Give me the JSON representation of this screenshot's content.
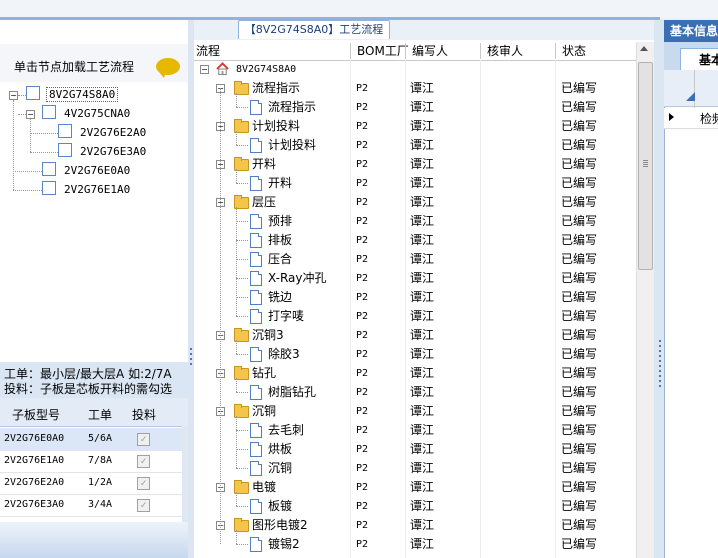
{
  "window": {
    "title": "【8V2G74S8A0】工艺流程"
  },
  "left_panel": {
    "hint": "单击节点加载工艺流程",
    "tree": [
      {
        "label": "8V2G74S8A0",
        "selected": true
      },
      {
        "label": "4V2G75CNA0"
      },
      {
        "label": "2V2G76E2A0"
      },
      {
        "label": "2V2G76E3A0"
      },
      {
        "label": "2V2G76E0A0"
      },
      {
        "label": "2V2G76E1A0"
      }
    ],
    "note_line1": "工单：最小层/最大层A 如:2/7A",
    "note_line2": "投料：子板是芯板开料的需勾选",
    "sub_table": {
      "headers": [
        "子板型号",
        "工单",
        "投料"
      ],
      "rows": [
        {
          "model": "2V2G76E0A0",
          "order": "5/6A",
          "feed": true
        },
        {
          "model": "2V2G76E1A0",
          "order": "7/8A",
          "feed": true
        },
        {
          "model": "2V2G76E2A0",
          "order": "1/2A",
          "feed": true
        },
        {
          "model": "2V2G76E3A0",
          "order": "3/4A",
          "feed": true
        }
      ]
    }
  },
  "process_table": {
    "headers": {
      "flow": "流程",
      "bom": "BOM工厂",
      "writer": "编写人",
      "reviewer": "核审人",
      "status": "状态"
    },
    "rows": [
      {
        "name": "8V2G74S8A0",
        "type": "root",
        "level": 0,
        "bom": "",
        "writer": "",
        "status": ""
      },
      {
        "name": "流程指示",
        "type": "folder",
        "level": 1,
        "bom": "P2",
        "writer": "谭江",
        "status": "已编写"
      },
      {
        "name": "流程指示",
        "type": "file",
        "level": 2,
        "bom": "P2",
        "writer": "谭江",
        "status": "已编写"
      },
      {
        "name": "计划投料",
        "type": "folder",
        "level": 1,
        "bom": "P2",
        "writer": "谭江",
        "status": "已编写"
      },
      {
        "name": "计划投料",
        "type": "file",
        "level": 2,
        "bom": "P2",
        "writer": "谭江",
        "status": "已编写"
      },
      {
        "name": "开料",
        "type": "folder",
        "level": 1,
        "bom": "P2",
        "writer": "谭江",
        "status": "已编写"
      },
      {
        "name": "开料",
        "type": "file",
        "level": 2,
        "bom": "P2",
        "writer": "谭江",
        "status": "已编写"
      },
      {
        "name": "层压",
        "type": "folder",
        "level": 1,
        "bom": "P2",
        "writer": "谭江",
        "status": "已编写"
      },
      {
        "name": "预排",
        "type": "file",
        "level": 2,
        "bom": "P2",
        "writer": "谭江",
        "status": "已编写"
      },
      {
        "name": "排板",
        "type": "file",
        "level": 2,
        "bom": "P2",
        "writer": "谭江",
        "status": "已编写"
      },
      {
        "name": "压合",
        "type": "file",
        "level": 2,
        "bom": "P2",
        "writer": "谭江",
        "status": "已编写"
      },
      {
        "name": "X-Ray冲孔",
        "type": "file",
        "level": 2,
        "bom": "P2",
        "writer": "谭江",
        "status": "已编写"
      },
      {
        "name": "铣边",
        "type": "file",
        "level": 2,
        "bom": "P2",
        "writer": "谭江",
        "status": "已编写"
      },
      {
        "name": "打字唛",
        "type": "file",
        "level": 2,
        "bom": "P2",
        "writer": "谭江",
        "status": "已编写"
      },
      {
        "name": "沉铜3",
        "type": "folder",
        "level": 1,
        "bom": "P2",
        "writer": "谭江",
        "status": "已编写"
      },
      {
        "name": "除胶3",
        "type": "file",
        "level": 2,
        "bom": "P2",
        "writer": "谭江",
        "status": "已编写"
      },
      {
        "name": "钻孔",
        "type": "folder",
        "level": 1,
        "bom": "P2",
        "writer": "谭江",
        "status": "已编写"
      },
      {
        "name": "树脂钻孔",
        "type": "file",
        "level": 2,
        "bom": "P2",
        "writer": "谭江",
        "status": "已编写"
      },
      {
        "name": "沉铜",
        "type": "folder",
        "level": 1,
        "bom": "P2",
        "writer": "谭江",
        "status": "已编写"
      },
      {
        "name": "去毛刺",
        "type": "file",
        "level": 2,
        "bom": "P2",
        "writer": "谭江",
        "status": "已编写"
      },
      {
        "name": "烘板",
        "type": "file",
        "level": 2,
        "bom": "P2",
        "writer": "谭江",
        "status": "已编写"
      },
      {
        "name": "沉铜",
        "type": "file",
        "level": 2,
        "bom": "P2",
        "writer": "谭江",
        "status": "已编写"
      },
      {
        "name": "电镀",
        "type": "folder",
        "level": 1,
        "bom": "P2",
        "writer": "谭江",
        "status": "已编写"
      },
      {
        "name": "板镀",
        "type": "file",
        "level": 2,
        "bom": "P2",
        "writer": "谭江",
        "status": "已编写"
      },
      {
        "name": "图形电镀2",
        "type": "folder",
        "level": 1,
        "bom": "P2",
        "writer": "谭江",
        "status": "已编写"
      },
      {
        "name": "镀锡2",
        "type": "file",
        "level": 2,
        "bom": "P2",
        "writer": "谭江",
        "status": "已编写"
      }
    ]
  },
  "right_panel": {
    "title": "基本信息",
    "tab": "基本",
    "row_text": "检频"
  },
  "colors": {
    "accent": "#3a6fb3",
    "folder": "#f3c64b",
    "file_border": "#4f7fc0"
  }
}
